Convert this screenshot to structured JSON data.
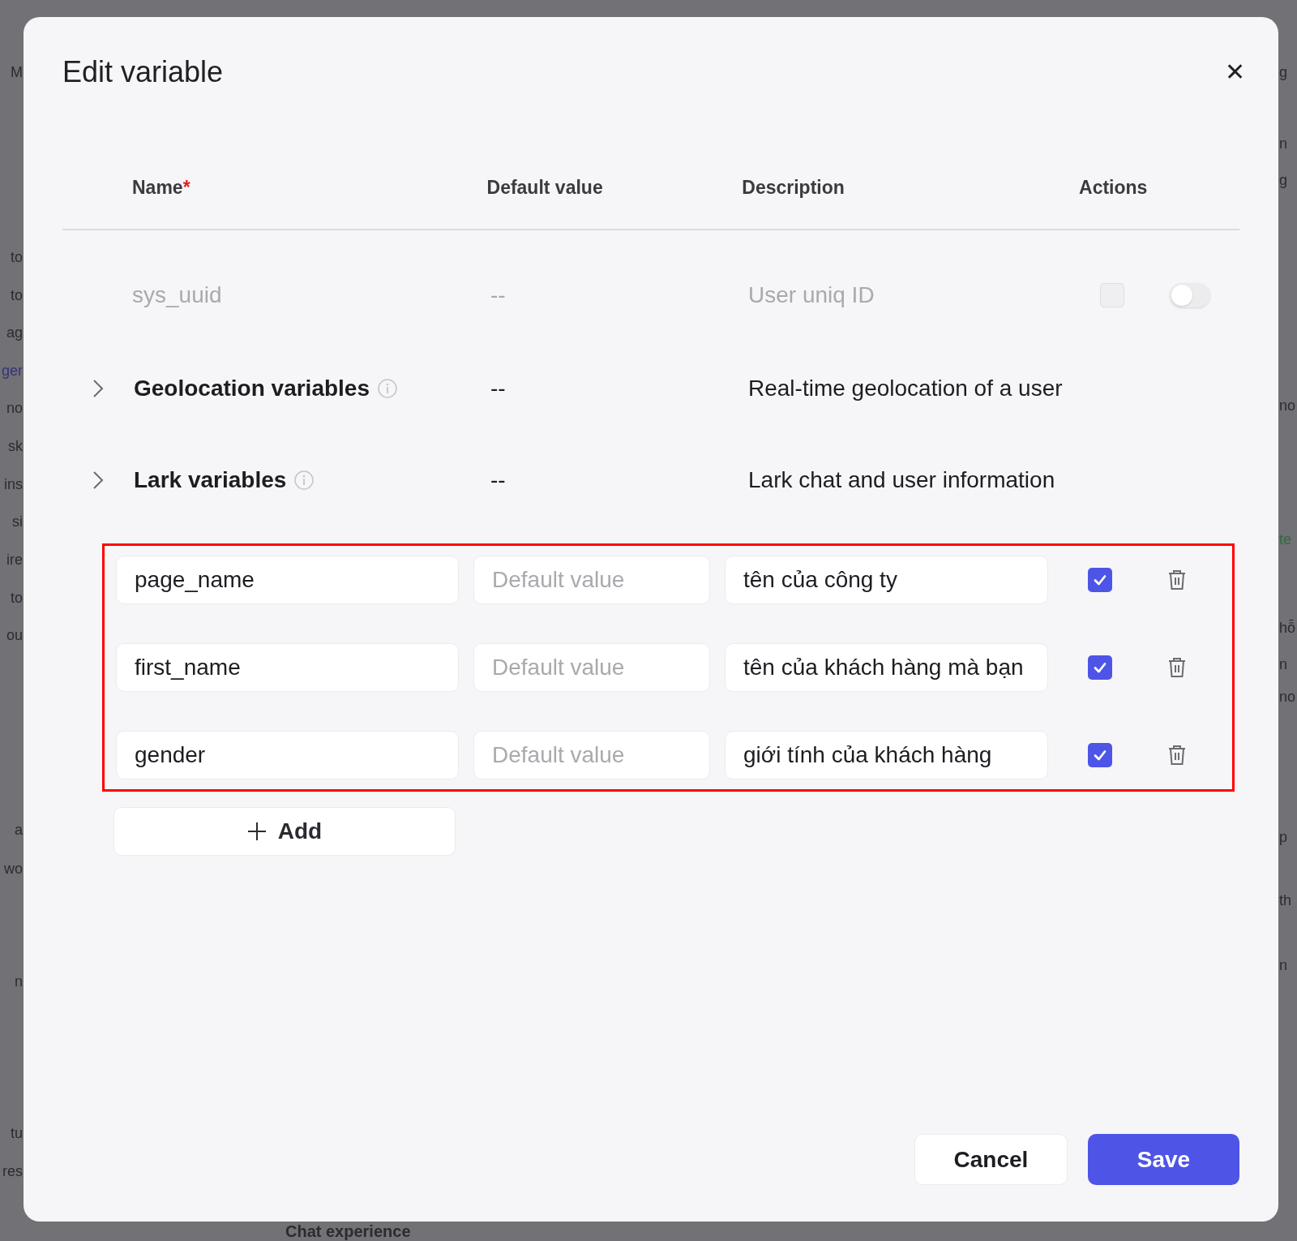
{
  "backdrop": {
    "left_fragments": [
      {
        "text": "M",
        "color": "#2b2b30"
      },
      {
        "text": "to",
        "color": "#2b2b30"
      },
      {
        "text": "to",
        "color": "#2b2b30"
      },
      {
        "text": "ag",
        "color": "#2b2b30"
      },
      {
        "text": "ger",
        "color": "#34347a"
      },
      {
        "text": "no",
        "color": "#2b2b30"
      },
      {
        "text": "sk",
        "color": "#2b2b30"
      },
      {
        "text": "ins",
        "color": "#2b2b30"
      },
      {
        "text": "si",
        "color": "#2b2b30"
      },
      {
        "text": "ire",
        "color": "#2b2b30"
      },
      {
        "text": "to",
        "color": "#2b2b30"
      },
      {
        "text": "ou",
        "color": "#2b2b30"
      },
      {
        "text": "a",
        "color": "#2b2b30"
      },
      {
        "text": "wo",
        "color": "#2b2b30"
      },
      {
        "text": "n",
        "color": "#2b2b30"
      },
      {
        "text": "tu",
        "color": "#2b2b30"
      },
      {
        "text": "res",
        "color": "#2b2b30"
      }
    ],
    "right_fragments": [
      {
        "text": "g",
        "color": "#2b2b30"
      },
      {
        "text": "n",
        "color": "#2b2b30"
      },
      {
        "text": "g",
        "color": "#2b2b30"
      },
      {
        "text": "no",
        "color": "#2b2b30"
      },
      {
        "text": "te",
        "color": "#2f6b3a"
      },
      {
        "text": "hỗ",
        "color": "#2b2b30"
      },
      {
        "text": "n",
        "color": "#2b2b30"
      },
      {
        "text": "no",
        "color": "#2b2b30"
      },
      {
        "text": "p",
        "color": "#2b2b30"
      },
      {
        "text": "th",
        "color": "#2b2b30"
      },
      {
        "text": "n",
        "color": "#2b2b30"
      }
    ],
    "bottom_heading": "Chat experience"
  },
  "dialog": {
    "title": "Edit variable",
    "close": "✕",
    "columns": [
      {
        "label": "Name",
        "required_mark": "*"
      },
      {
        "label": "Default value"
      },
      {
        "label": "Description"
      },
      {
        "label": "Actions"
      }
    ],
    "system_rows": [
      {
        "name": "sys_uuid",
        "default": "--",
        "description": "User uniq ID",
        "checked": false,
        "disabled": true,
        "toggle_on": false
      }
    ],
    "groups": [
      {
        "name": "Geolocation variables",
        "default": "--",
        "description": "Real-time geolocation of a user",
        "expanded": false
      },
      {
        "name": "Lark variables",
        "default": "--",
        "description": "Lark chat and user information",
        "expanded": false
      }
    ],
    "custom": {
      "highlighted": true,
      "rows": [
        {
          "name": "page_name",
          "default_placeholder": "Default value",
          "description": "tên của công ty",
          "checked": true
        },
        {
          "name": "first_name",
          "default_placeholder": "Default value",
          "description": "tên của khách hàng mà bạn",
          "checked": true
        },
        {
          "name": "gender",
          "default_placeholder": "Default value",
          "description": "giới tính của khách hàng",
          "checked": true
        }
      ]
    },
    "add_button": "Add",
    "buttons": [
      {
        "label": "Cancel",
        "kind": "secondary"
      },
      {
        "label": "Save",
        "kind": "primary"
      }
    ]
  }
}
